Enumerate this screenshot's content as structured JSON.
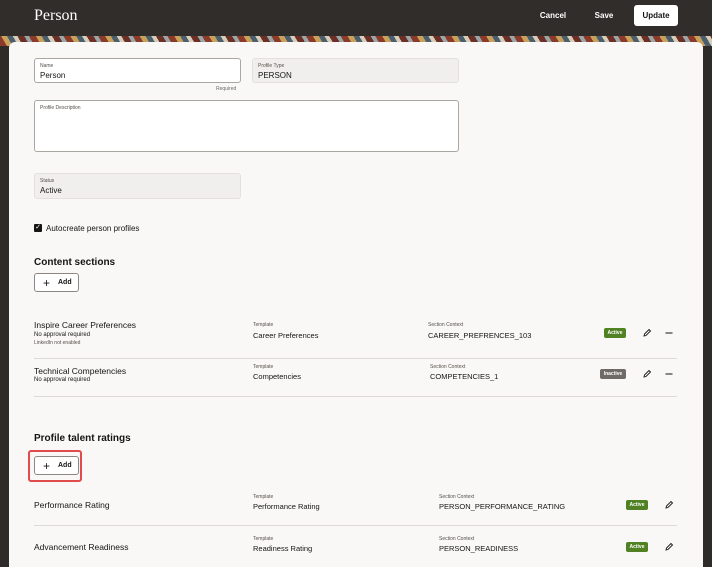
{
  "header": {
    "title": "Person",
    "cancel_label": "Cancel",
    "save_label": "Save",
    "update_label": "Update"
  },
  "form": {
    "name": {
      "label": "Name",
      "value": "Person",
      "help": "Required"
    },
    "profile_type": {
      "label": "Profile Type",
      "value": "PERSON"
    },
    "profile_description": {
      "label": "Profile Description",
      "value": ""
    },
    "status": {
      "label": "Status",
      "value": "Active"
    },
    "autocreate": {
      "label": "Autocreate person profiles",
      "checked": true
    }
  },
  "content_sections": {
    "title": "Content sections",
    "add_label": "Add",
    "rows": [
      {
        "name": "Inspire Career Preferences",
        "sub1": "No approval required",
        "sub2": "LinkedIn not enabled",
        "template_label": "Template",
        "template": "Career Preferences",
        "context_label": "Section Context",
        "context": "CAREER_PREFRENCES_103",
        "status": "Active"
      },
      {
        "name": "Technical Competencies",
        "sub1": "No approval required",
        "template_label": "Template",
        "template": "Competencies",
        "context_label": "Section Context",
        "context": "COMPETENCIES_1",
        "status": "Inactive"
      }
    ]
  },
  "talent_ratings": {
    "title": "Profile talent ratings",
    "add_label": "Add",
    "rows": [
      {
        "name": "Performance Rating",
        "template_label": "Template",
        "template": "Performance Rating",
        "context_label": "Section Context",
        "context": "PERSON_PERFORMANCE_RATING",
        "status": "Active"
      },
      {
        "name": "Advancement Readiness",
        "template_label": "Template",
        "template": "Readiness Rating",
        "context_label": "Section Context",
        "context": "PERSON_READINESS",
        "status": "Active"
      }
    ]
  },
  "colors": {
    "header_bg": "#312d2a",
    "active_badge": "#508223",
    "inactive_badge": "#6f6a65",
    "highlight": "#e04b4b"
  },
  "icons": {
    "edit": "pencil-icon",
    "remove": "minus-icon",
    "add": "plus-icon",
    "check": "checkbox-checked-icon"
  }
}
